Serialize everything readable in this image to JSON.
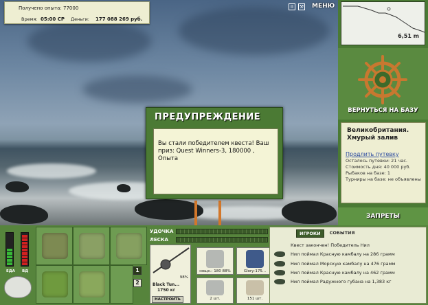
{
  "info": {
    "xp_text": "Получено опыта: 77000",
    "time_label": "Время:",
    "time_value": "05:00 СР",
    "money_label": "Деньги:",
    "money_value": "177 088 269 руб."
  },
  "top_menu": {
    "icon_1": "II",
    "icon_2": "⚒",
    "menu_label": "МЕНЮ"
  },
  "dialog": {
    "title": "ПРЕДУПРЕЖДЕНИЕ",
    "message": "Вы стали победителем квеста! Ваш приз: Quest Winners-3, 180000 , Опыта"
  },
  "depth_map": {
    "depth": "6,51 m"
  },
  "base": {
    "return_label": "ВЕРНУТЬСЯ НА БАЗУ"
  },
  "location": {
    "title": "Великобритания. Хмурый залив",
    "trip_link": "Продлить путевку",
    "lines": [
      "Осталось путевки: 21 час.",
      "Стоимость дня: 40 000 руб.",
      "Рыбаков на базе: 1",
      "Турниры на базе: не объявлены"
    ]
  },
  "bans_label": "ЗАПРЕТЫ",
  "meters": {
    "left_label": "ЕДА",
    "right_label": "ВД",
    "food_level": 0.55,
    "right_level": 0.95,
    "green": "#37b837",
    "red": "#d02020"
  },
  "inventory": {
    "page_1": "1",
    "page_2": "2"
  },
  "rod": {
    "rod_label": "УДОЧКА",
    "line_label": "ЛЕСКА",
    "rod_name": "Black Tun...",
    "rod_weight": "1750 кг",
    "rod_percent": "98%",
    "setup_label": "НАСТРОИТЬ",
    "tackle": [
      {
        "caption": "нощн.: 180 88%"
      },
      {
        "caption": "Glory-175..."
      },
      {
        "caption": "2 шт."
      },
      {
        "caption": "151 шт."
      }
    ]
  },
  "events": {
    "tab_players": "ИГРОКИ",
    "tab_events": "СОБЫТИЯ",
    "quest_text": "Квест закончен! Победитель Нил",
    "catches": [
      "Нил поймал Красную камбалу на 286 грамм",
      "Нил поймал Морскую камбалу на 476 грамм",
      "Нил поймал Красную камбалу на 462 грамм",
      "Нил поймал Радужного губана на 1,383 кг"
    ]
  }
}
